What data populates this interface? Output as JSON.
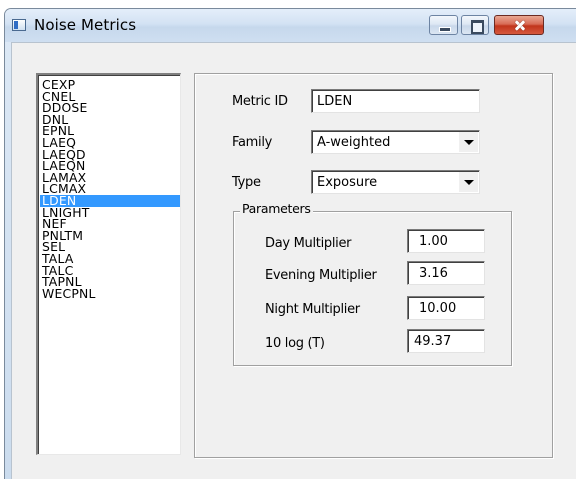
{
  "window": {
    "title": "Noise Metrics"
  },
  "metrics_list": {
    "items": [
      "CEXP",
      "CNEL",
      "DDOSE",
      "DNL",
      "EPNL",
      "LAEQ",
      "LAEQD",
      "LAEQN",
      "LAMAX",
      "LCMAX",
      "LDEN",
      "LNIGHT",
      "NEF",
      "PNLTM",
      "SEL",
      "TALA",
      "TALC",
      "TAPNL",
      "WECPNL"
    ],
    "selected": "LDEN"
  },
  "form": {
    "metric_id_label": "Metric ID",
    "metric_id_value": "LDEN",
    "family_label": "Family",
    "family_value": "A-weighted",
    "type_label": "Type",
    "type_value": "Exposure"
  },
  "parameters": {
    "group_label": "Parameters",
    "day_label": "Day Multiplier",
    "day_value": "1.00",
    "evening_label": "Evening Multiplier",
    "evening_value": "3.16",
    "night_label": "Night Multiplier",
    "night_value": "10.00",
    "tlog_label": "10 log (T)",
    "tlog_value": "49.37"
  },
  "colors": {
    "selection": "#3399ff",
    "dialog_face": "#f0f0f0",
    "close_button": "#c8432a"
  }
}
